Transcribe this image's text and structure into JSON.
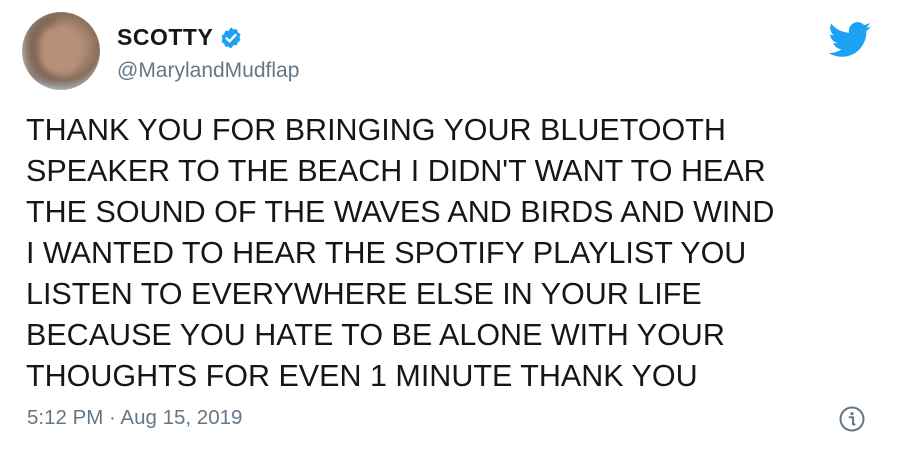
{
  "author": {
    "display_name": "SCOTTY",
    "handle": "@MarylandMudflap",
    "verified": true
  },
  "tweet": {
    "lines": [
      "THANK YOU FOR BRINGING YOUR BLUETOOTH",
      "SPEAKER TO THE BEACH I DIDN'T WANT TO HEAR",
      "THE SOUND OF THE WAVES AND BIRDS AND WIND",
      "I WANTED TO HEAR THE SPOTIFY PLAYLIST YOU",
      "LISTEN TO EVERYWHERE ELSE IN YOUR LIFE",
      "BECAUSE YOU HATE TO BE ALONE WITH YOUR",
      "THOUGHTS FOR EVEN 1 MINUTE THANK YOU"
    ],
    "timestamp": "5:12 PM · Aug 15, 2019"
  },
  "icons": {
    "brand": "twitter-bird-icon",
    "verified": "verified-badge-icon",
    "info": "info-icon"
  },
  "colors": {
    "twitter_blue": "#1da1f2",
    "text": "#14171a",
    "secondary": "#657786"
  }
}
